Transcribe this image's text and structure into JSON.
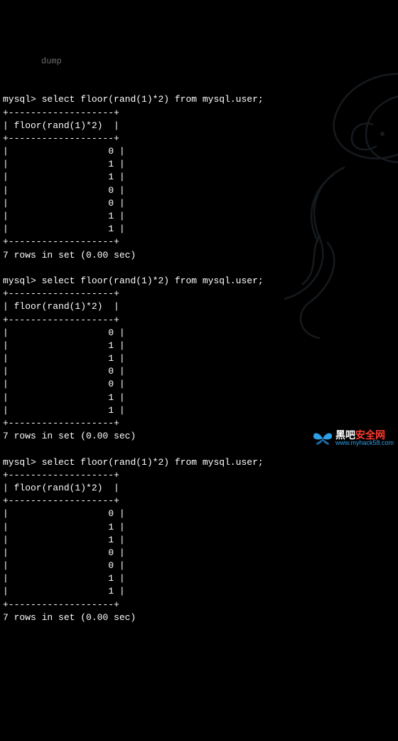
{
  "terminal": {
    "prompt": "mysql>",
    "query": "select floor(rand(1)*2) from mysql.user;",
    "border": "+-------------------+",
    "header": "| floor(rand(1)*2)  |",
    "rows": [
      "0",
      "1",
      "1",
      "0",
      "0",
      "1",
      "1"
    ],
    "status": "7 rows in set (0.00 sec)",
    "ghost_label": "dump"
  },
  "watermark": {
    "cn_part1": "黑吧",
    "cn_part2": "安全网",
    "url": "www.myhack58.com"
  }
}
